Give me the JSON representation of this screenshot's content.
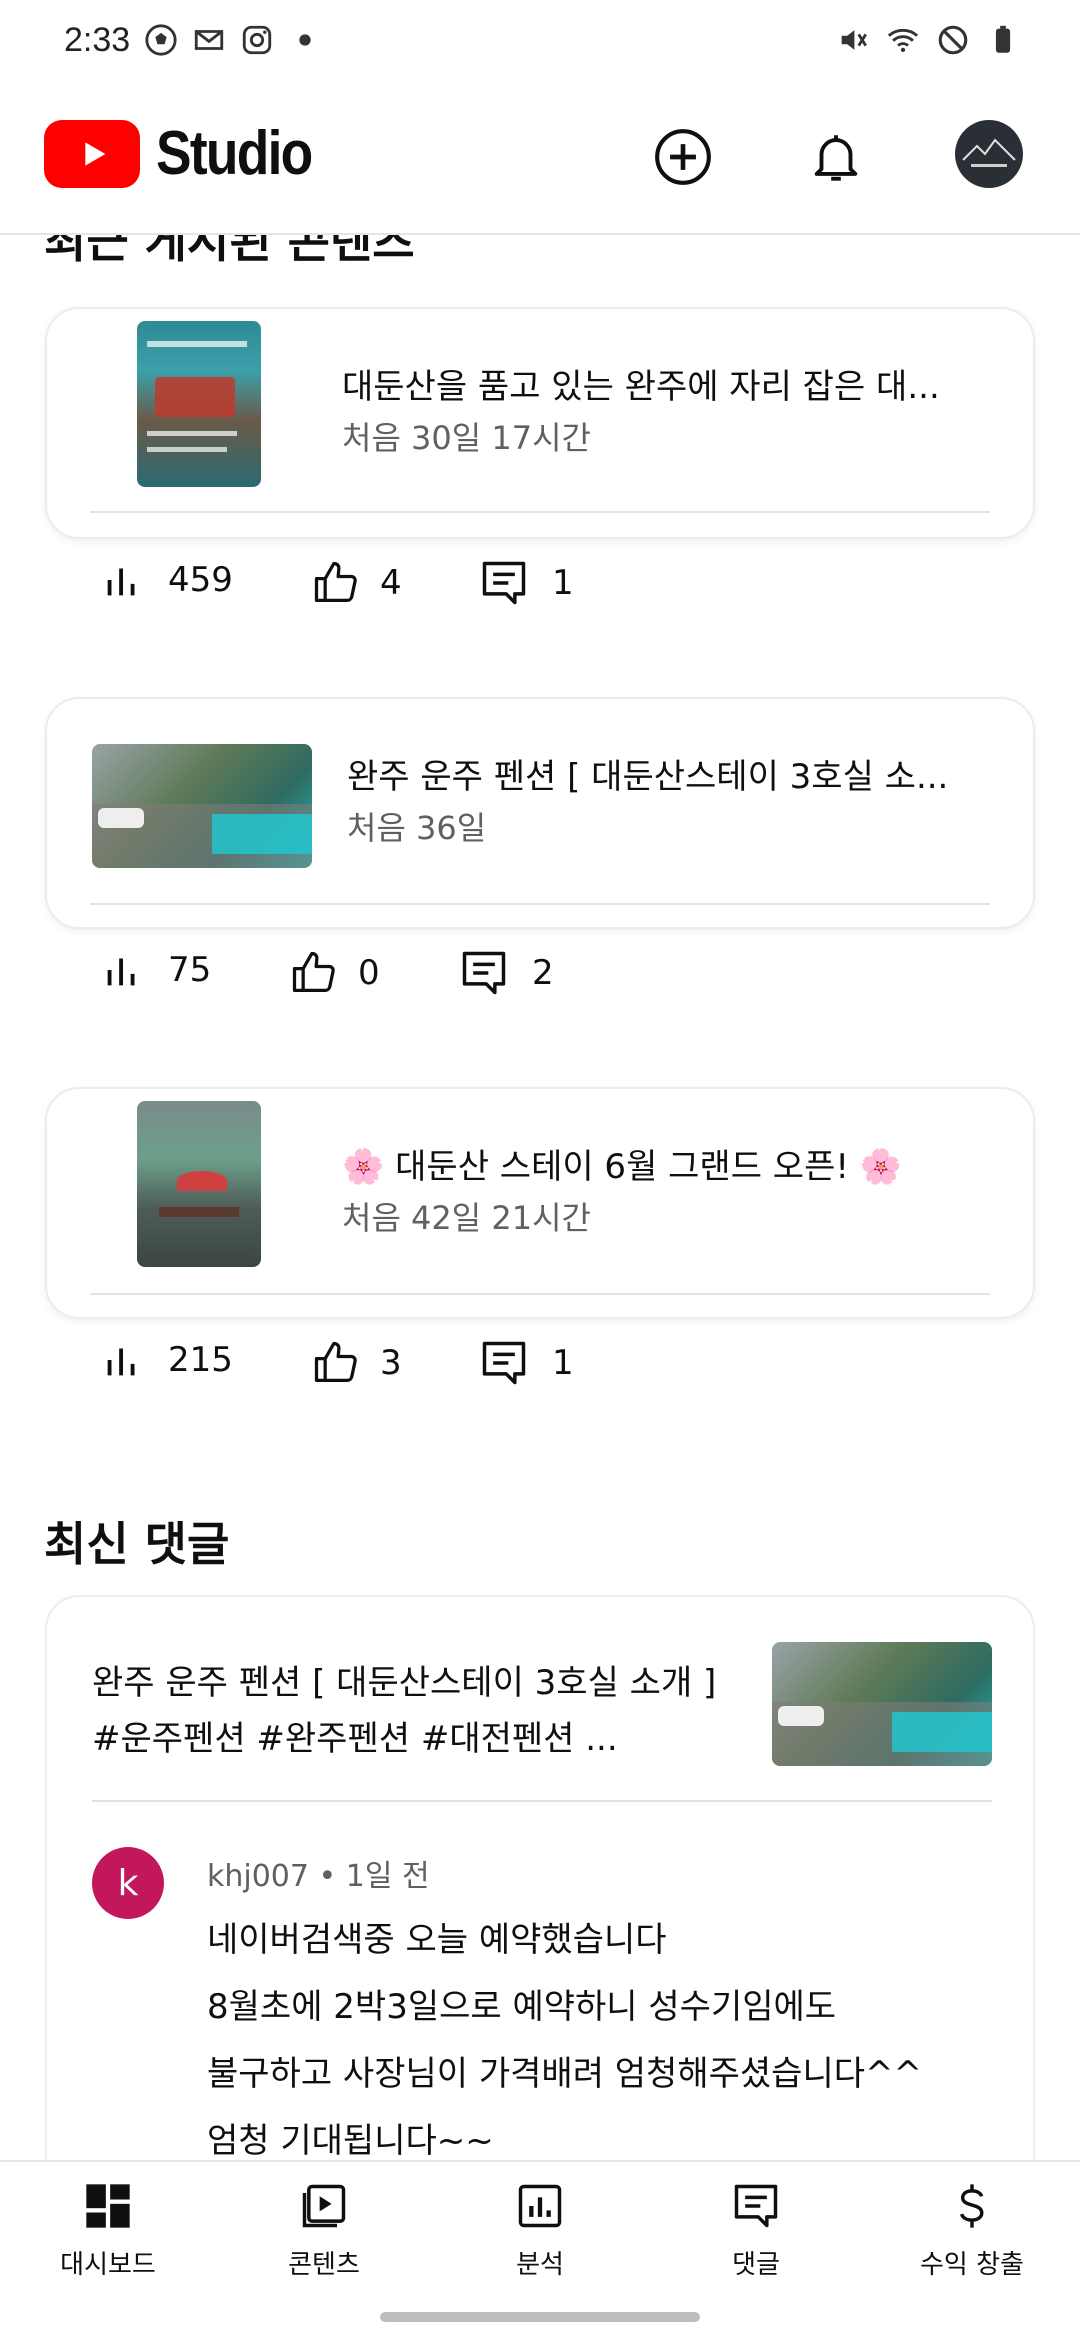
{
  "status_bar": {
    "time": "2:33"
  },
  "header": {
    "brand": "Studio"
  },
  "content_section": {
    "title": "최근 게시된 콘텐츠"
  },
  "videos": [
    {
      "title": "대둔산을 품고 있는 완주에 자리 잡은 대...",
      "age": "처음 30일 17시간",
      "views": "459",
      "likes": "4",
      "comments": "1"
    },
    {
      "title": "완주 운주 펜션 [ 대둔산스테이 3호실 소...",
      "age": "처음 36일",
      "views": "75",
      "likes": "0",
      "comments": "2"
    },
    {
      "title": "🌸 대둔산 스테이 6월 그랜드 오픈! 🌸",
      "age": "처음 42일 21시간",
      "views": "215",
      "likes": "3",
      "comments": "1"
    }
  ],
  "comments_section": {
    "title": "최신 댓글",
    "video_title": "완주 운주 펜션 [ 대둔산스테이 3호실 소개 ] #운주펜션 #완주펜션 #대전펜션 ...",
    "avatar_letter": "k",
    "meta": "khj007 • 1일 전",
    "lines": [
      "네이버검색중 오늘 예약했습니다",
      "8월초에 2박3일으로 예약하니 성수기임에도",
      "불구하고 사장님이 가격배려 엄청해주셨습니다^^",
      "엄청 기대됩니다~~"
    ]
  },
  "nav": [
    {
      "label": "대시보드",
      "icon": "dashboard-icon"
    },
    {
      "label": "콘텐츠",
      "icon": "content-icon"
    },
    {
      "label": "분석",
      "icon": "analytics-icon"
    },
    {
      "label": "댓글",
      "icon": "comments-icon"
    },
    {
      "label": "수익 창출",
      "icon": "monetization-icon"
    }
  ],
  "colors": {
    "brand_red": "#ff0000",
    "avatar_pink": "#c2185b"
  }
}
